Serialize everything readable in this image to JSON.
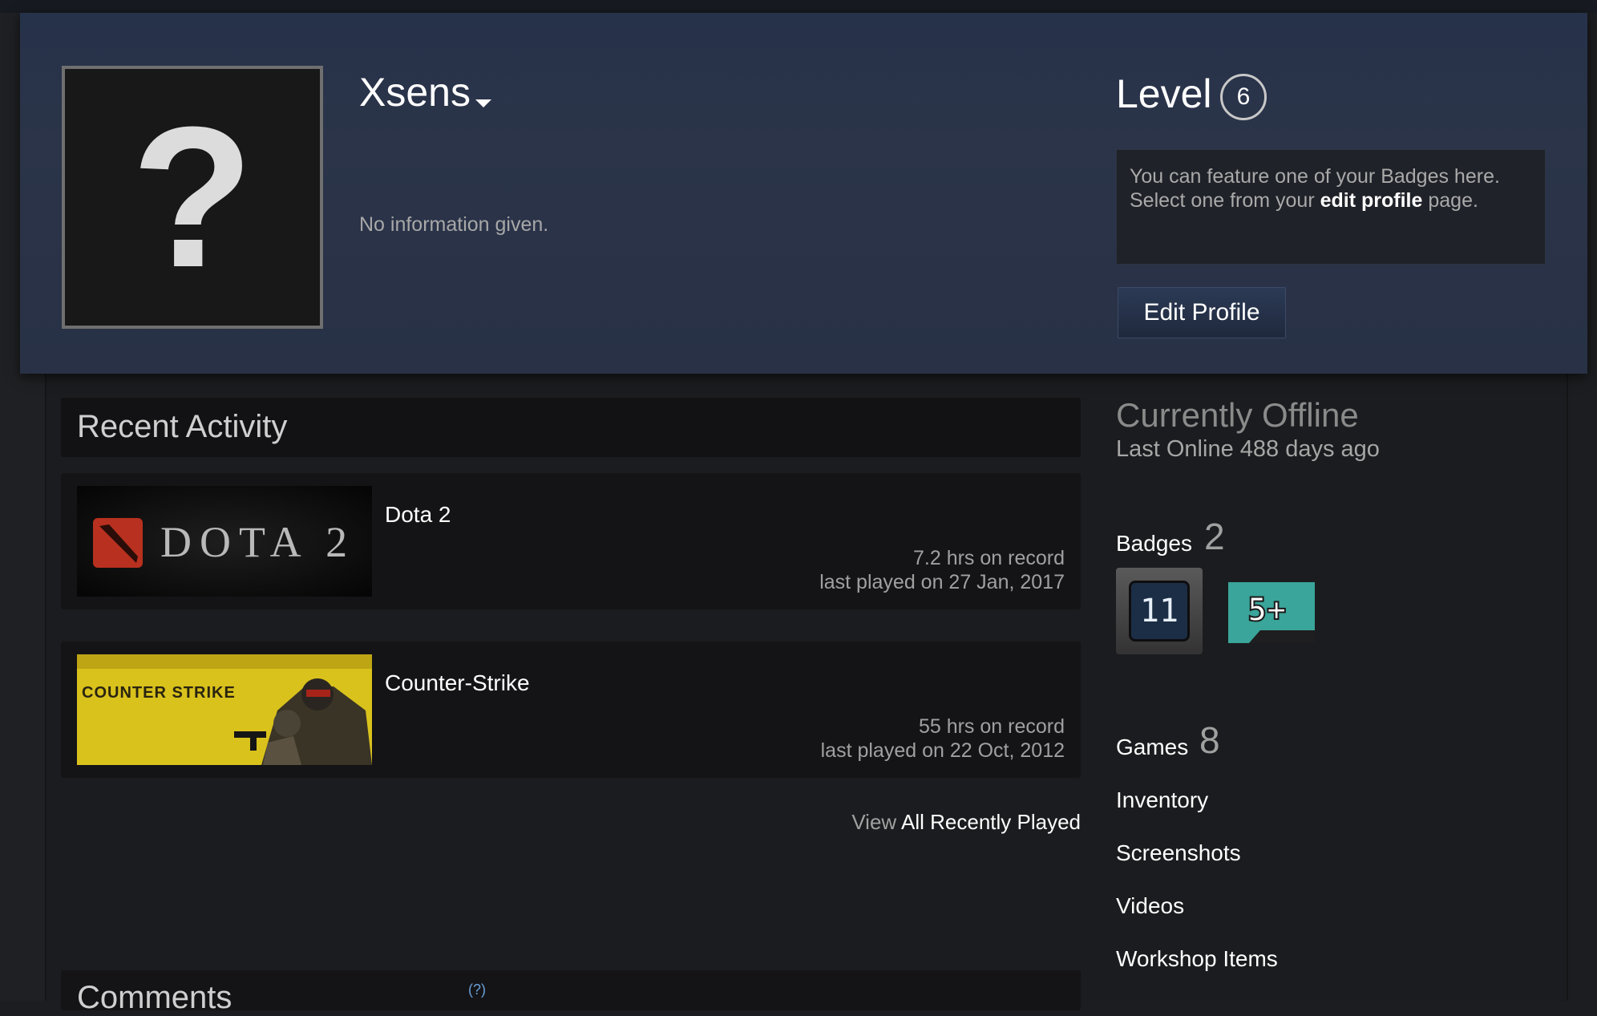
{
  "profile": {
    "persona_name": "Xsens",
    "summary": "No information given.",
    "level_label": "Level",
    "level": "6",
    "badge_hint_line1": "You can feature one of your Badges here.",
    "badge_hint_line2_prefix": "Select one from your",
    "badge_hint_link": "edit profile",
    "badge_hint_line2_suffix": "page.",
    "edit_button": "Edit Profile"
  },
  "recent_activity": {
    "title": "Recent Activity",
    "games": [
      {
        "name": "Dota 2",
        "hours": "7.2 hrs on record",
        "last_played": "last played on 27 Jan, 2017",
        "logo_text": "DOTA 2"
      },
      {
        "name": "Counter-Strike",
        "hours": "55 hrs on record",
        "last_played": "last played on 22 Oct, 2012",
        "logo_text": "COUNTER STRIKE"
      }
    ],
    "view_prefix": "View",
    "view_link": "All Recently Played"
  },
  "comments": {
    "title": "Comments",
    "help": "(?)"
  },
  "sidebar": {
    "status_title": "Currently Offline",
    "status_sub": "Last Online 488 days ago",
    "badges_label": "Badges",
    "badges_count": "2",
    "badge_items": [
      {
        "text": "11"
      },
      {
        "text": "5+"
      }
    ],
    "games_label": "Games",
    "games_count": "8",
    "links": [
      "Inventory",
      "Screenshots",
      "Videos",
      "Workshop Items"
    ]
  },
  "colors": {
    "header_bg": "#283145",
    "page_bg": "#1c1d20",
    "panel_bg": "#141416",
    "text_primary": "#ffffff",
    "text_muted": "#a0a0a0",
    "badge_teal": "#3aa59a"
  }
}
